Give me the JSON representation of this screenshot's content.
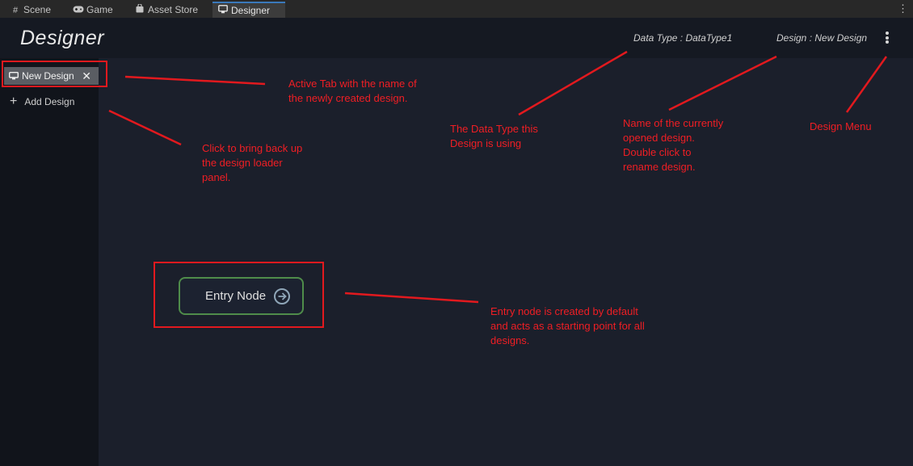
{
  "editor_tabs": [
    {
      "label": "Scene",
      "icon": "grid-icon"
    },
    {
      "label": "Game",
      "icon": "gamepad-icon"
    },
    {
      "label": "Asset Store",
      "icon": "shopping-bag-icon"
    },
    {
      "label": "Designer",
      "icon": "monitor-icon",
      "active": true
    }
  ],
  "header": {
    "title": "Designer",
    "data_type": "Data Type : DataType1",
    "design_name": "Design : New Design",
    "menu_icon": "kebab-menu-icon"
  },
  "sidebar": {
    "active_tab_label": "New Design",
    "active_tab_icon": "monitor-icon",
    "close_icon": "close-icon",
    "add_design_label": "Add Design",
    "add_icon": "plus-icon"
  },
  "canvas": {
    "entry_node_label": "Entry Node",
    "entry_node_icon": "entry-port-icon"
  },
  "annotations": {
    "active_tab": [
      "Active Tab with the name of",
      "the newly created design."
    ],
    "add_design": [
      "Click to bring back up",
      "the design loader",
      "panel."
    ],
    "data_type": [
      "The Data Type this",
      "Design is using"
    ],
    "design_name": [
      "Name of the currently",
      "opened design.",
      "Double click to",
      "rename design."
    ],
    "design_menu": [
      "Design Menu"
    ],
    "entry_node": [
      "Entry node is created by default",
      "and acts as a starting point for all",
      "designs."
    ]
  },
  "colors": {
    "annotation_red": "#e2191e",
    "canvas_bg": "#1b1f2b",
    "node_border": "#4f8c4a"
  }
}
